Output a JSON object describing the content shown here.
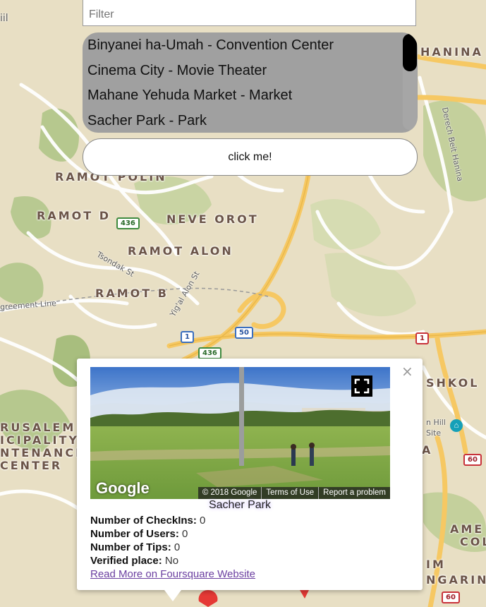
{
  "filter": {
    "placeholder": "Filter",
    "value": ""
  },
  "places": [
    "Binyanei ha-Umah - Convention Center",
    "Cinema City - Movie Theater",
    "Mahane Yehuda Market - Market",
    "Sacher Park - Park"
  ],
  "button": {
    "label": "click me!"
  },
  "map": {
    "neighborhoods": {
      "ramot_polin": "RAMOT POLIN",
      "ramot_d": "RAMOT D",
      "neve_orot": "NEVE OROT",
      "ramot_alon": "RAMOT ALON",
      "ramot_b": "RAMOT B",
      "hanina": "HANINA",
      "eshkol": "SHKOL",
      "jerusalem_1": "RUSALEM",
      "jerusalem_2": "ICIPALITY",
      "jerusalem_3": "NTENANCE",
      "jerusalem_4": "CENTER",
      "amer": "AME",
      "col": "COL",
      "im": "IM",
      "ngarin": "NGARIN",
      "partial_a": "A",
      "partial_il": "iil"
    },
    "streets": {
      "derech_beit_hanina": "Derech Beit Hanina",
      "tsondak": "Tsondak St",
      "yigal_alon": "Yig'al Alon St",
      "green_line": "greement Line"
    },
    "place_label": "n Hill\nSite",
    "shields": {
      "s436a": "436",
      "s436b": "436",
      "s1a": "1",
      "s50": "50",
      "s1b": "1",
      "s60a": "60",
      "s60b": "60"
    }
  },
  "infowindow": {
    "close_symbol": "×",
    "streetview": {
      "logo": "Google",
      "copyright": "© 2018 Google",
      "terms": "Terms of Use",
      "report": "Report a problem"
    },
    "title": "Sacher Park",
    "checkins_label": "Number of CheckIns:",
    "checkins_value": "0",
    "users_label": "Number of Users:",
    "users_value": "0",
    "tips_label": "Number of Tips:",
    "tips_value": "0",
    "verified_label": "Verified place:",
    "verified_value": "No",
    "link_text": "Read More on Foursquare Website"
  },
  "colors": {
    "map_bg": "#e8dfc4",
    "park_green": "#a8be7e",
    "road_yellow": "#f6c863",
    "road_white": "#ffffff",
    "list_bg": "#a0a0a0",
    "link_purple": "#6b3fa0"
  }
}
